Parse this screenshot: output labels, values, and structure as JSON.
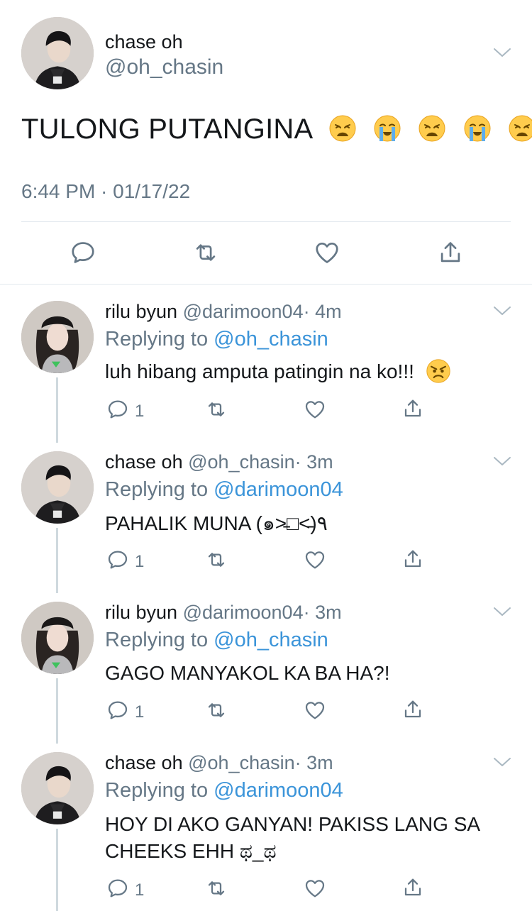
{
  "main_tweet": {
    "name": "chase oh",
    "handle": "@oh_chasin",
    "text": "TULONG PUTANGINA",
    "emojis": [
      "weary-face",
      "loudly-crying-face",
      "weary-face",
      "loudly-crying-face",
      "weary-face"
    ],
    "timestamp": "6:44 PM · 01/17/22"
  },
  "replies": [
    {
      "name": "rilu byun",
      "handle": "@darimoon04",
      "time": "· 4m",
      "replying_prefix": "Replying to",
      "replying_to": "@oh_chasin",
      "text": "luh hibang amputa patingin na ko!!!",
      "emoji": "angry-face",
      "reply_count": "1"
    },
    {
      "name": "chase oh",
      "handle": "@oh_chasin",
      "time": "· 3m",
      "replying_prefix": "Replying to",
      "replying_to": "@darimoon04",
      "text": "PAHALIK MUNA (๑˃̵□˂̵)٩",
      "reply_count": "1"
    },
    {
      "name": "rilu byun",
      "handle": "@darimoon04",
      "time": "· 3m",
      "replying_prefix": "Replying to",
      "replying_to": "@oh_chasin",
      "text": "GAGO MANYAKOL KA BA HA?!",
      "reply_count": "1"
    },
    {
      "name": "chase oh",
      "handle": "@oh_chasin",
      "time": "· 3m",
      "replying_prefix": "Replying to",
      "replying_to": "@darimoon04",
      "text": "HOY DI AKO GANYAN! PAKISS LANG SA CHEEKS EHH ಥ_ಥ",
      "reply_count": "1"
    }
  ],
  "colors": {
    "text_primary": "#14171a",
    "text_secondary": "#657786",
    "link": "#3b94d9",
    "divider": "#e1e8ed",
    "thread_line": "#cfd9de"
  }
}
